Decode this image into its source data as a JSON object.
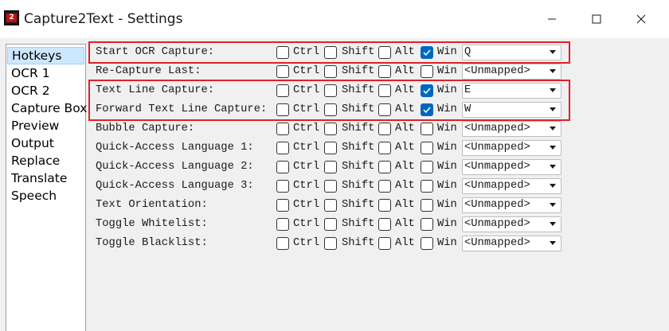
{
  "window": {
    "title": "Capture2Text - Settings",
    "icon": "capture2text-app-icon",
    "controls": [
      "minimize-icon",
      "maximize-icon",
      "close-icon"
    ]
  },
  "sidebar": {
    "items": [
      {
        "label": "Hotkeys",
        "selected": true
      },
      {
        "label": "OCR 1",
        "selected": false
      },
      {
        "label": "OCR 2",
        "selected": false
      },
      {
        "label": "Capture Box",
        "selected": false
      },
      {
        "label": "Preview",
        "selected": false
      },
      {
        "label": "Output",
        "selected": false
      },
      {
        "label": "Replace",
        "selected": false
      },
      {
        "label": "Translate",
        "selected": false
      },
      {
        "label": "Speech",
        "selected": false
      }
    ]
  },
  "modifiers": {
    "ctrl": "Ctrl",
    "shift": "Shift",
    "alt": "Alt",
    "win": "Win"
  },
  "hotkeys": [
    {
      "label": "Start OCR Capture:",
      "ctrl": false,
      "shift": false,
      "alt": false,
      "win": true,
      "key": "Q",
      "highlighted": true
    },
    {
      "label": "Re-Capture Last:",
      "ctrl": false,
      "shift": false,
      "alt": false,
      "win": false,
      "key": "<Unmapped>",
      "highlighted": false
    },
    {
      "label": "Text Line Capture:",
      "ctrl": false,
      "shift": false,
      "alt": false,
      "win": true,
      "key": "E",
      "highlighted": true
    },
    {
      "label": "Forward Text Line Capture:",
      "ctrl": false,
      "shift": false,
      "alt": false,
      "win": true,
      "key": "W",
      "highlighted": true
    },
    {
      "label": "Bubble Capture:",
      "ctrl": false,
      "shift": false,
      "alt": false,
      "win": false,
      "key": "<Unmapped>",
      "highlighted": false
    },
    {
      "label": "Quick-Access Language 1:",
      "ctrl": false,
      "shift": false,
      "alt": false,
      "win": false,
      "key": "<Unmapped>",
      "highlighted": false
    },
    {
      "label": "Quick-Access Language 2:",
      "ctrl": false,
      "shift": false,
      "alt": false,
      "win": false,
      "key": "<Unmapped>",
      "highlighted": false
    },
    {
      "label": "Quick-Access Language 3:",
      "ctrl": false,
      "shift": false,
      "alt": false,
      "win": false,
      "key": "<Unmapped>",
      "highlighted": false
    },
    {
      "label": "Text Orientation:",
      "ctrl": false,
      "shift": false,
      "alt": false,
      "win": false,
      "key": "<Unmapped>",
      "highlighted": false
    },
    {
      "label": "Toggle Whitelist:",
      "ctrl": false,
      "shift": false,
      "alt": false,
      "win": false,
      "key": "<Unmapped>",
      "highlighted": false
    },
    {
      "label": "Toggle Blacklist:",
      "ctrl": false,
      "shift": false,
      "alt": false,
      "win": false,
      "key": "<Unmapped>",
      "highlighted": false
    }
  ],
  "colors": {
    "highlight": "#e0202a",
    "checkbox_checked": "#0067c0",
    "selection": "#cce8ff"
  }
}
